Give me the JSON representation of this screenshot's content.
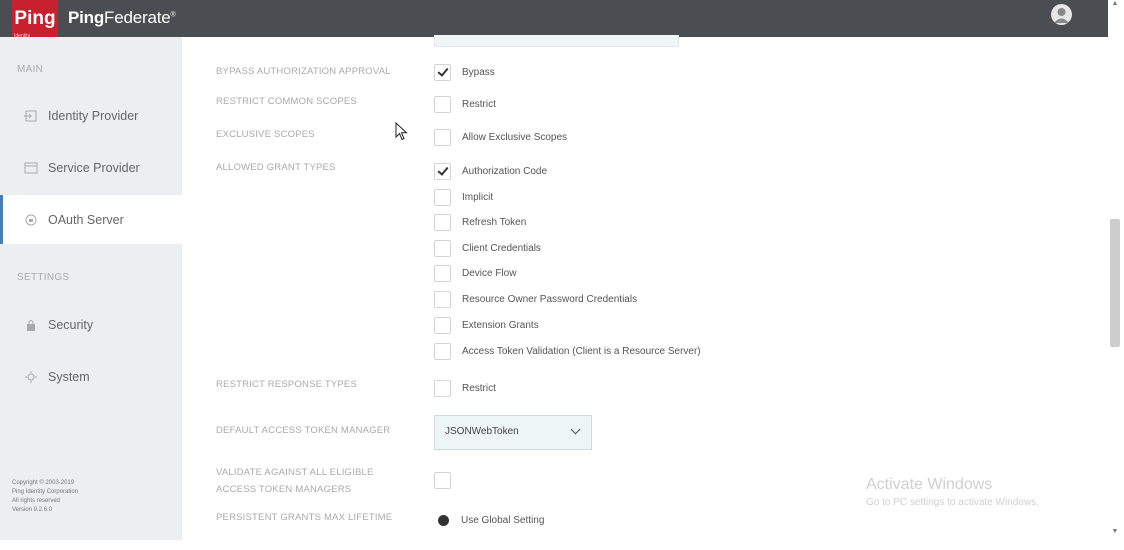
{
  "header": {
    "logo_text": "Ping",
    "logo_subtext": "Identity",
    "app_name_bold": "Ping",
    "app_name_rest": "Federate",
    "app_name_mark": "®"
  },
  "sidebar": {
    "main_section": "MAIN",
    "settings_section": "SETTINGS",
    "items": [
      {
        "label": "Identity Provider",
        "icon": "identity-provider-icon"
      },
      {
        "label": "Service Provider",
        "icon": "service-provider-icon"
      },
      {
        "label": "OAuth Server",
        "icon": "oauth-server-icon"
      },
      {
        "label": "Security",
        "icon": "security-icon"
      },
      {
        "label": "System",
        "icon": "system-icon"
      }
    ],
    "footer": [
      "Copyright © 2003-2019",
      "Ping Identity Corporation",
      "All rights reserved",
      "Version 9.2.6.0"
    ]
  },
  "form": {
    "bypass": {
      "label": "BYPASS AUTHORIZATION APPROVAL",
      "option": "Bypass",
      "checked": true
    },
    "restrict_scopes": {
      "label": "RESTRICT COMMON SCOPES",
      "option": "Restrict",
      "checked": false
    },
    "exclusive_scopes": {
      "label": "EXCLUSIVE SCOPES",
      "option": "Allow Exclusive Scopes",
      "checked": false
    },
    "grant_types": {
      "label": "ALLOWED GRANT TYPES",
      "options": [
        {
          "label": "Authorization Code",
          "checked": true
        },
        {
          "label": "Implicit",
          "checked": false
        },
        {
          "label": "Refresh Token",
          "checked": false
        },
        {
          "label": "Client Credentials",
          "checked": false
        },
        {
          "label": "Device Flow",
          "checked": false
        },
        {
          "label": "Resource Owner Password Credentials",
          "checked": false
        },
        {
          "label": "Extension Grants",
          "checked": false
        },
        {
          "label": "Access Token Validation (Client is a Resource Server)",
          "checked": false
        }
      ]
    },
    "restrict_response": {
      "label": "RESTRICT RESPONSE TYPES",
      "option": "Restrict",
      "checked": false
    },
    "token_manager": {
      "label": "DEFAULT ACCESS TOKEN MANAGER",
      "value": "JSONWebToken"
    },
    "validate_all": {
      "label_line1": "VALIDATE AGAINST ALL ELIGIBLE",
      "label_line2": "ACCESS TOKEN MANAGERS",
      "checked": false
    },
    "persistent_grants": {
      "label": "PERSISTENT GRANTS MAX LIFETIME",
      "option": "Use Global Setting",
      "selected": true
    }
  },
  "watermark": {
    "title": "Activate Windows",
    "subtitle": "Go to PC settings to activate Windows."
  },
  "colors": {
    "topbar": "#4a4d52",
    "logo": "#c8202f",
    "sidebar": "#edeef0",
    "active_indicator": "#4a7cb5"
  }
}
